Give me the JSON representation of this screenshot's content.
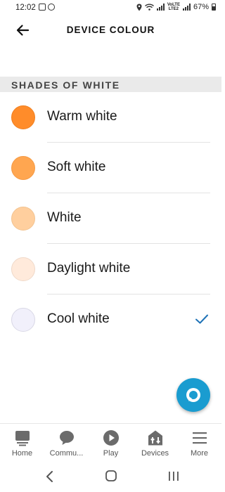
{
  "status_bar": {
    "time": "12:02",
    "volte_top": "VoLTE",
    "volte_bottom": "LTE2",
    "battery": "67%"
  },
  "header": {
    "title": "DEVICE COLOUR",
    "back_icon": "arrow-left-icon"
  },
  "section": {
    "title": "SHADES OF WHITE"
  },
  "colors": [
    {
      "label": "Warm white",
      "swatch": "#ff8c2a",
      "selected": false
    },
    {
      "label": "Soft white",
      "swatch": "#ffa650",
      "selected": false
    },
    {
      "label": "White",
      "swatch": "#ffcf9e",
      "selected": false
    },
    {
      "label": "Daylight white",
      "swatch": "#ffeadb",
      "selected": false
    },
    {
      "label": "Cool white",
      "swatch": "#f1f0fb",
      "selected": true
    }
  ],
  "accent_color": "#1a9cd0",
  "check_color": "#1f73b7",
  "fab_icon": "alexa-icon",
  "bottom_nav": [
    {
      "label": "Home",
      "icon": "home-icon"
    },
    {
      "label": "Commu...",
      "icon": "chat-bubble-icon"
    },
    {
      "label": "Play",
      "icon": "play-icon"
    },
    {
      "label": "Devices",
      "icon": "devices-icon"
    },
    {
      "label": "More",
      "icon": "menu-icon"
    }
  ],
  "system_nav": [
    "back-chevron-icon",
    "home-circle-icon",
    "recents-icon"
  ]
}
